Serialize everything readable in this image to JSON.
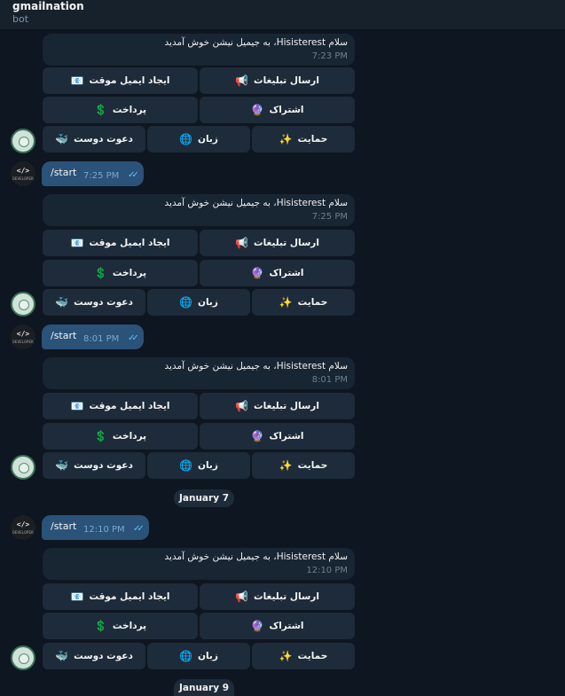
{
  "header": {
    "title": "gmailnation",
    "subtitle": "bot"
  },
  "welcome_text": "سلام Hisisterest، به جیمیل نیشن خوش آمدید",
  "keyboard": {
    "row1": [
      {
        "label": "ارسال تبلیغات",
        "icon": "📢"
      },
      {
        "label": "ایجاد ایمیل موقت",
        "icon": "📧"
      }
    ],
    "row2": [
      {
        "label": "اشتراک",
        "icon": "🔮"
      },
      {
        "label": "پرداخت",
        "icon": "💲"
      }
    ],
    "row3": [
      {
        "label": "حمایت",
        "icon": "✨"
      },
      {
        "label": "زبان",
        "icon": "🌐"
      },
      {
        "label": "دعوت دوست",
        "icon": "🐳"
      }
    ]
  },
  "user_avatar": {
    "code": "</>",
    "label": "DEVELOPER"
  },
  "messages": [
    {
      "bot_time": "7:23 PM",
      "user_cmd": "/start",
      "user_time": "7:25 PM"
    },
    {
      "bot_time": "7:25 PM",
      "user_cmd": "/start",
      "user_time": "8:01 PM"
    },
    {
      "bot_time": "8:01 PM",
      "user_cmd": "/start",
      "user_time": "12:10 PM"
    },
    {
      "bot_time": "12:10 PM"
    }
  ],
  "dates": [
    "January 7",
    "January 9"
  ]
}
